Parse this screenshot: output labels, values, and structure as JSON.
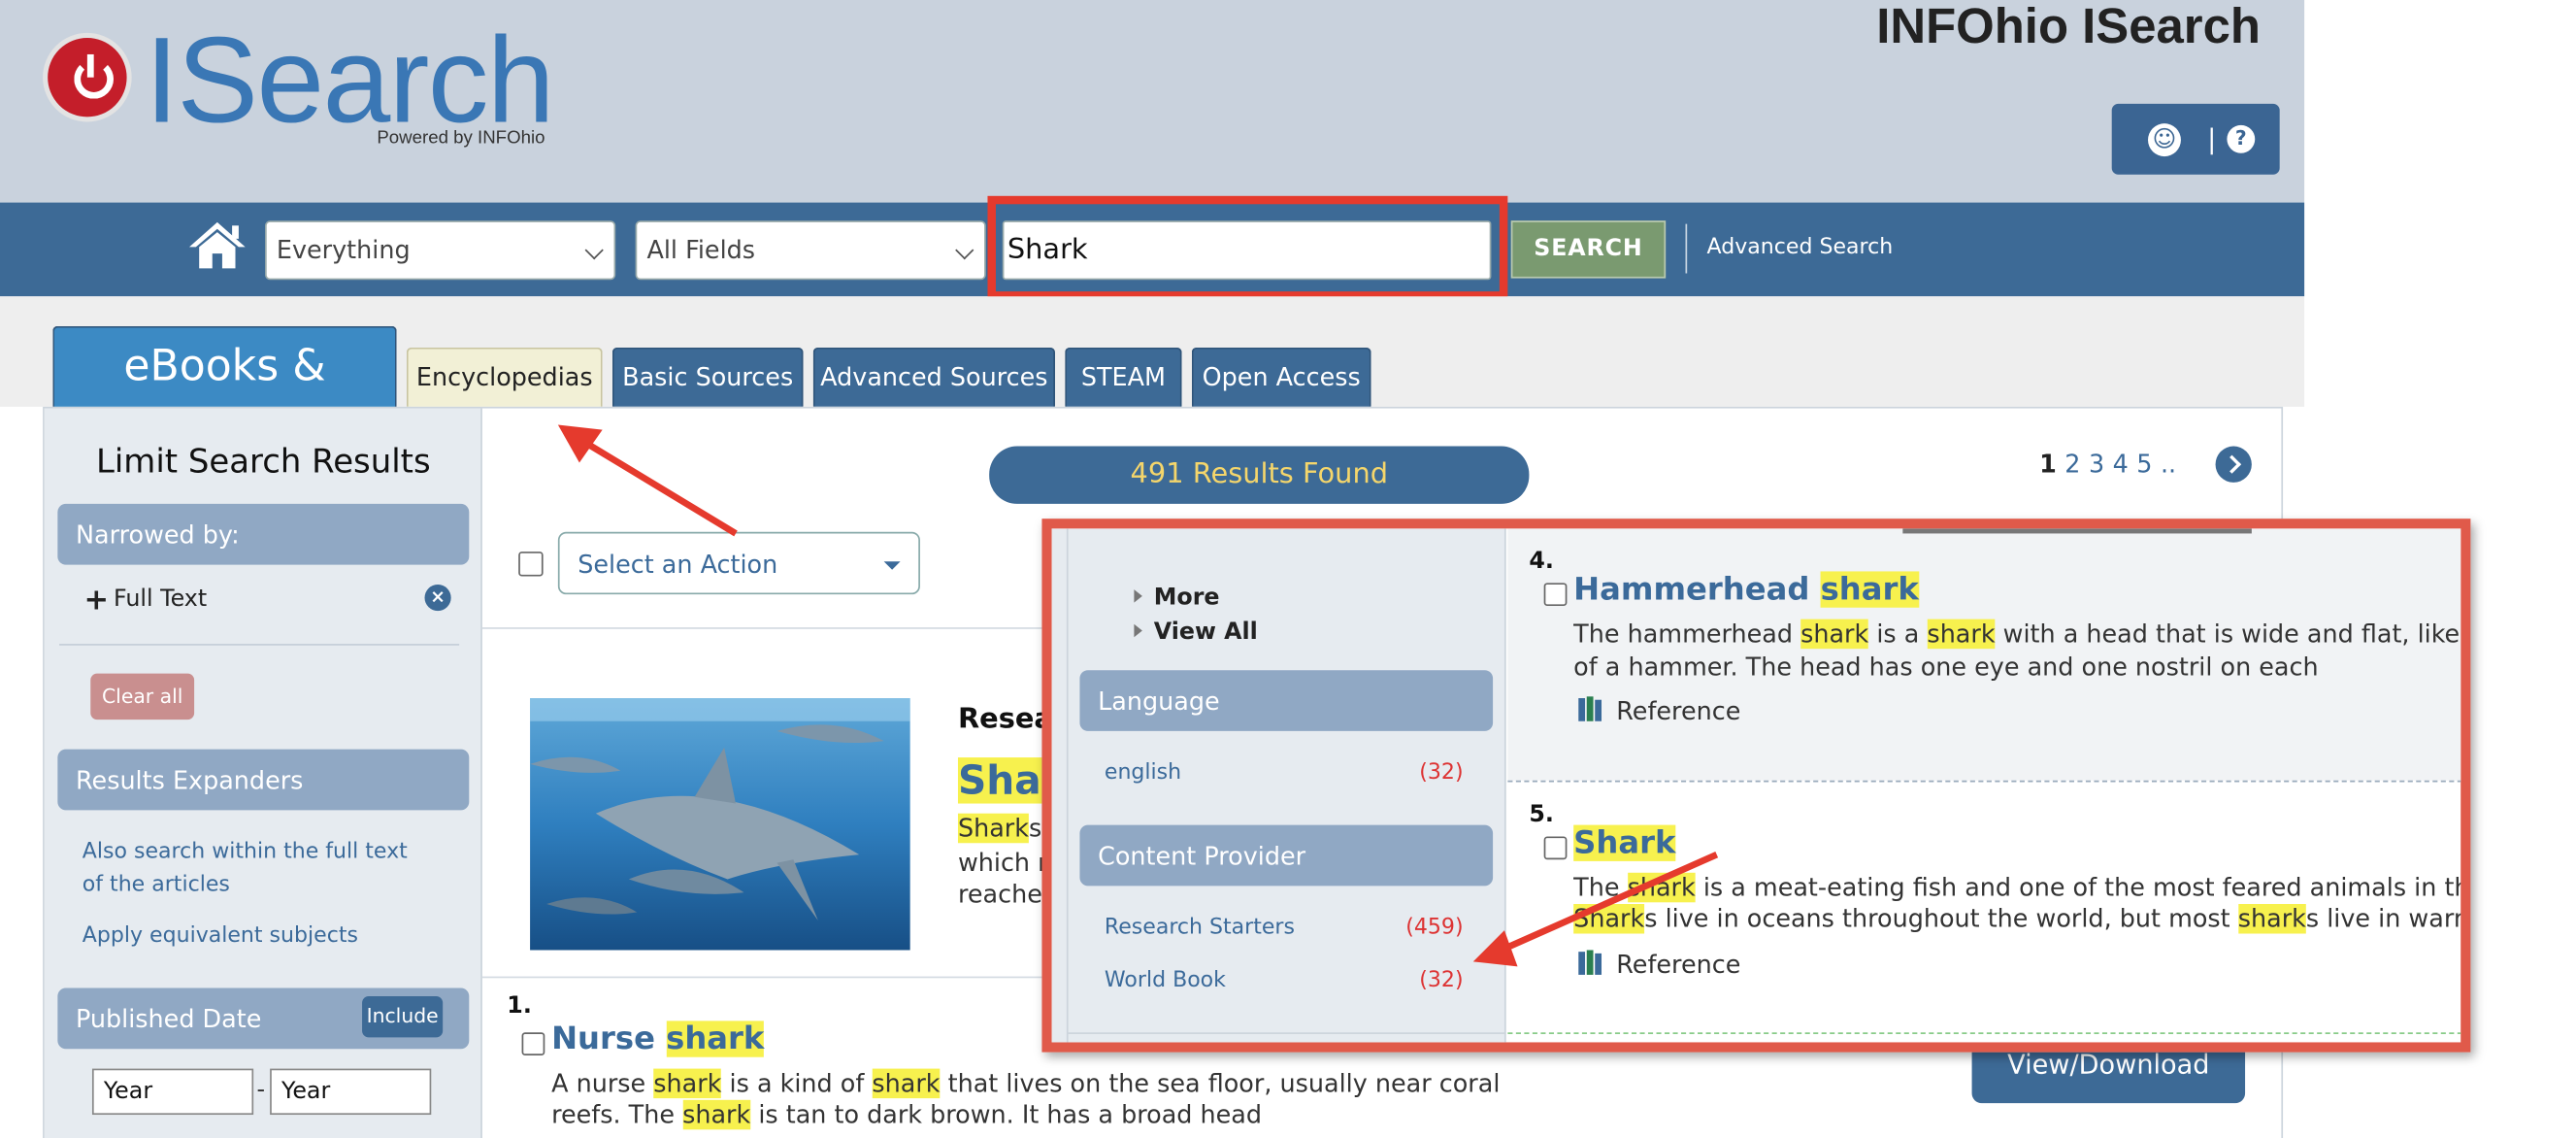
{
  "header": {
    "logo_text": "ISearch",
    "logo_sub": "Powered by INFOhio",
    "site_title": "INFOhio ISearch",
    "util_separator": "|"
  },
  "search": {
    "scope_value": "Everything",
    "fields_value": "All Fields",
    "query": "Shark",
    "search_label": "SEARCH",
    "advanced_label": "Advanced Search"
  },
  "tabs": [
    {
      "label": "eBooks & Videos"
    },
    {
      "label": "Encyclopedias"
    },
    {
      "label": "Basic Sources"
    },
    {
      "label": "Advanced Sources"
    },
    {
      "label": "STEAM"
    },
    {
      "label": "Open Access"
    }
  ],
  "sidebar": {
    "title": "Limit Search Results",
    "narrowed_by": "Narrowed by:",
    "full_text": "Full Text",
    "clear_all": "Clear all",
    "expanders_head": "Results Expanders",
    "expander_1": "Also search within the full text of the articles",
    "expander_2": "Apply equivalent subjects",
    "date_head": "Published Date",
    "include_label": "Include",
    "year_from": "Year",
    "year_to": "Year",
    "dash": "-"
  },
  "results": {
    "count_label": "491 Results Found",
    "pages": [
      "1",
      "2",
      "3",
      "4",
      "5",
      ".."
    ],
    "action_placeholder": "Select an Action",
    "view_download": "View/Download"
  },
  "featured": {
    "label": "Resea",
    "title_hl": "Shar",
    "snippet_1_hl": "Shark",
    "snippet_1_rest": "s a",
    "snippet_2": "which m",
    "snippet_3": "reaches"
  },
  "result_1": {
    "number": "1.",
    "title_a": "Nurse ",
    "title_hl": "shark",
    "s1_a": "A nurse ",
    "s1_hl1": "shark",
    "s1_b": " is a kind of ",
    "s1_hl2": "shark",
    "s1_c": " that lives on the sea floor, usually near coral",
    "s2_a": "reefs. The ",
    "s2_hl": "shark",
    "s2_b": " is tan to dark brown. It has a broad head"
  },
  "zoom": {
    "more": "More",
    "view_all": "View All",
    "language_head": "Language",
    "english": "english",
    "english_count": "(32)",
    "provider_head": "Content Provider",
    "research_starters": "Research Starters",
    "research_starters_count": "(459)",
    "world_book": "World Book",
    "world_book_count": "(32)",
    "r4_number": "4.",
    "r4_title_a": "Hammerhead ",
    "r4_title_hl": "shark",
    "r4_s1_a": "The hammerhead ",
    "r4_s1_hl1": "shark",
    "r4_s1_b": " is a ",
    "r4_s1_hl2": "shark",
    "r4_s1_c": " with a head that is wide and flat, like the head",
    "r4_s2": "of a hammer. The head has one eye and one nostril on each",
    "r4_type": "Reference",
    "r5_number": "5.",
    "r5_title": "Shark",
    "r5_s1_a": "The ",
    "r5_s1_hl": "shark",
    "r5_s1_b": " is a meat-eating fish and one of the most feared animals in the sea.",
    "r5_s2_hl1": "Shark",
    "r5_s2_a": "s live in oceans throughout the world, but most ",
    "r5_s2_hl2": "shark",
    "r5_s2_b": "s live in warm seas",
    "r5_type": "Reference"
  },
  "colors": {
    "header_bg": "#c9d2dd",
    "nav_blue": "#3d6a96",
    "accent_red": "#e53a2d",
    "highlight": "#f7f14e",
    "link_blue": "#3b6a9a"
  },
  "icons": [
    "home-icon",
    "accessibility-icon",
    "help-icon",
    "chevron-down-icon",
    "close-icon",
    "plus-icon",
    "next-page-icon",
    "book-icon"
  ]
}
